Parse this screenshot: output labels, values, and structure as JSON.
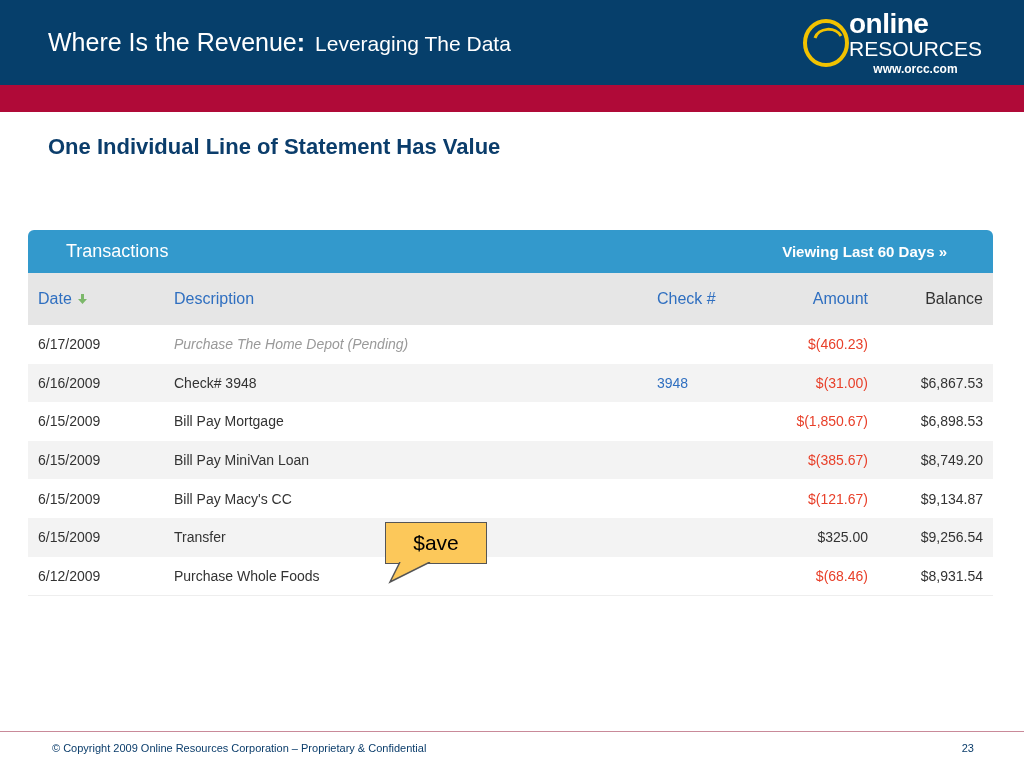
{
  "header": {
    "title": "Where Is the Revenue",
    "title_colon": ":",
    "subtitle": "Leveraging The Data",
    "logo": {
      "word_top": "online",
      "word_bottom": "RESOURCES",
      "url": "www.orcc.com"
    }
  },
  "heading": "One Individual Line of Statement Has Value",
  "transactions": {
    "title": "Viewing Last 60 Days »",
    "panel_title": "Transactions",
    "columns": [
      {
        "label": "Date",
        "kind": "link",
        "sorted": true
      },
      {
        "label": "Description",
        "kind": "link",
        "sorted": false
      },
      {
        "label": "Check #",
        "kind": "link",
        "sorted": false
      },
      {
        "label": "Amount",
        "kind": "link",
        "sorted": false
      },
      {
        "label": "Balance",
        "kind": "plain",
        "sorted": false
      }
    ],
    "rows": [
      {
        "date": "6/17/2009",
        "description": "Purchase The Home Depot (Pending)",
        "pending": true,
        "check": "",
        "amount": "$(460.23)",
        "negative": true,
        "balance": ""
      },
      {
        "date": "6/16/2009",
        "description": "Check# 3948",
        "pending": false,
        "check": "3948",
        "amount": "$(31.00)",
        "negative": true,
        "balance": "$6,867.53"
      },
      {
        "date": "6/15/2009",
        "description": "Bill Pay Mortgage",
        "pending": false,
        "check": "",
        "amount": "$(1,850.67)",
        "negative": true,
        "balance": "$6,898.53"
      },
      {
        "date": "6/15/2009",
        "description": "Bill Pay MiniVan Loan",
        "pending": false,
        "check": "",
        "amount": "$(385.67)",
        "negative": true,
        "balance": "$8,749.20"
      },
      {
        "date": "6/15/2009",
        "description": "Bill Pay Macy's CC",
        "pending": false,
        "check": "",
        "amount": "$(121.67)",
        "negative": true,
        "balance": "$9,134.87"
      },
      {
        "date": "6/15/2009",
        "description": "Transfer",
        "pending": false,
        "check": "",
        "amount": "$325.00",
        "negative": false,
        "balance": "$9,256.54"
      },
      {
        "date": "6/12/2009",
        "description": "Purchase Whole Foods",
        "pending": false,
        "check": "",
        "amount": "$(68.46)",
        "negative": true,
        "balance": "$8,931.54"
      }
    ]
  },
  "callout": "$ave",
  "footer": {
    "copyright": "© Copyright 2009 Online Resources Corporation – Proprietary & Confidential",
    "page": "23"
  }
}
